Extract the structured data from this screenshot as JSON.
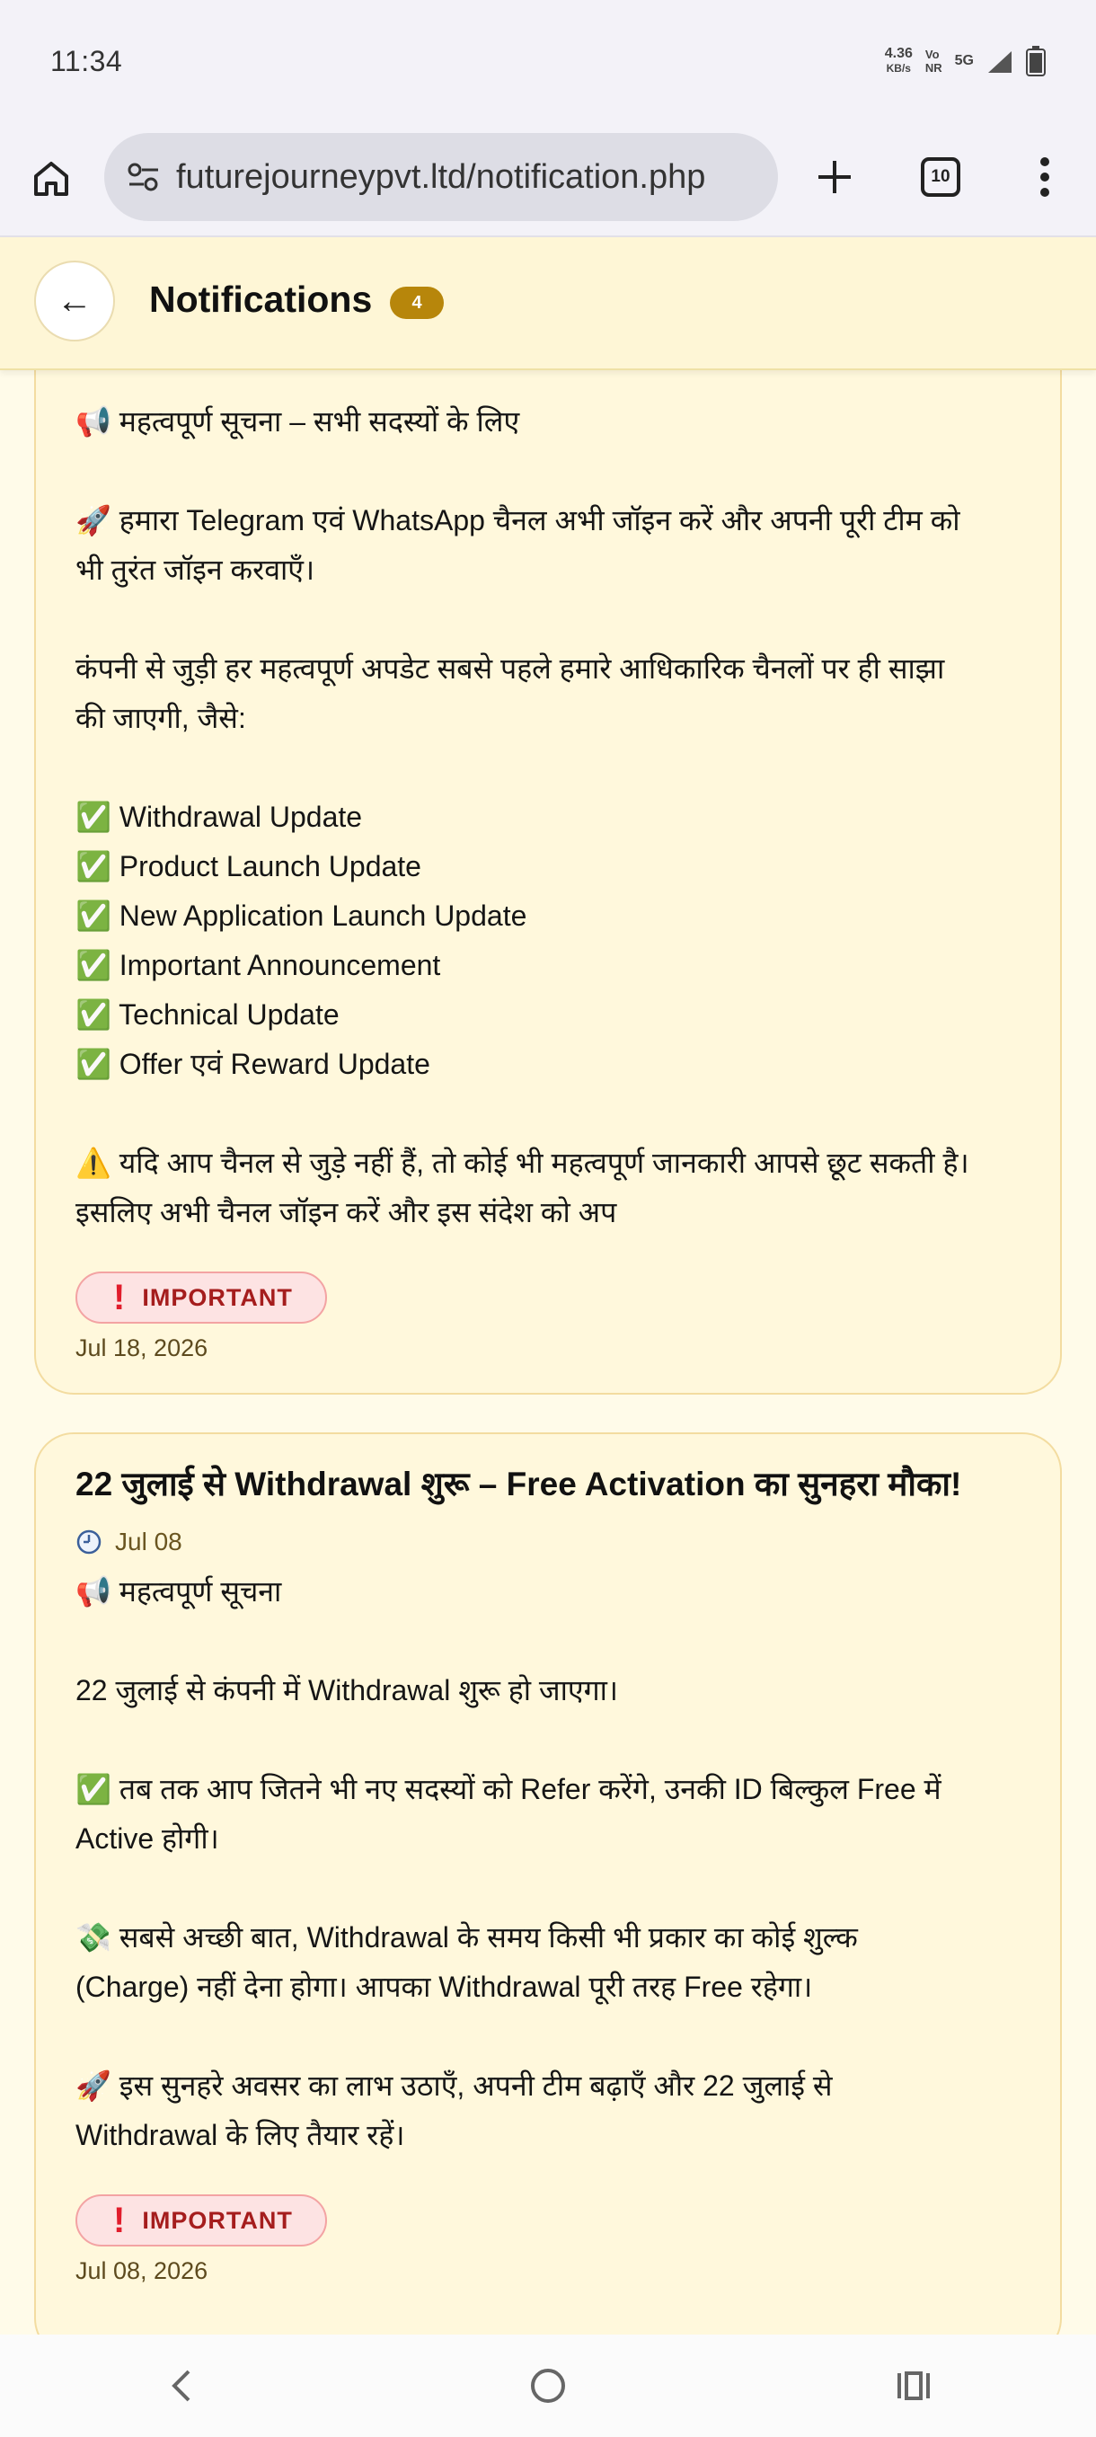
{
  "status_bar": {
    "time": "11:34",
    "net_speed_value": "4.36",
    "net_speed_unit": "KB/s",
    "volte_top": "Vo",
    "volte_bottom": "NR",
    "network": "5G"
  },
  "browser": {
    "url": "futurejourneypvt.ltd/notification.php",
    "tab_count": "10",
    "icons": [
      "home-icon",
      "site-settings-icon",
      "plus-icon",
      "tabs-icon",
      "more-vert-icon"
    ]
  },
  "header": {
    "back_arrow": "←",
    "title": "Notifications",
    "badge": "4"
  },
  "notifications": [
    {
      "lines": [
        "📢 महत्वपूर्ण सूचना – सभी सदस्यों के लिए",
        "",
        "🚀 हमारा Telegram एवं WhatsApp चैनल अभी जॉइन करें और अपनी पूरी टीम को",
        "भी तुरंत जॉइन करवाएँ।",
        "",
        "कंपनी से जुड़ी हर महत्वपूर्ण अपडेट सबसे पहले हमारे आधिकारिक चैनलों पर ही साझा",
        "की जाएगी, जैसे:",
        "",
        "✅ Withdrawal Update",
        "✅ Product Launch Update",
        "✅ New Application Launch Update",
        "✅ Important Announcement",
        "✅ Technical Update",
        "✅ Offer एवं Reward Update",
        "",
        "⚠️ यदि आप चैनल से जुड़े नहीं हैं, तो कोई भी महत्वपूर्ण जानकारी आपसे छूट सकती है।",
        "इसलिए अभी चैनल जॉइन करें और इस संदेश को अप"
      ],
      "badge_icon": "!",
      "badge": "IMPORTANT",
      "date": "Jul 18, 2026"
    },
    {
      "title": "22 जुलाई से Withdrawal शुरू – Free Activation का सुनहरा मौका!",
      "time_icon": "🕒",
      "short_date": "Jul 08",
      "lines": [
        "📢 महत्वपूर्ण सूचना",
        "",
        "22 जुलाई से कंपनी में Withdrawal शुरू हो जाएगा।",
        "",
        "✅ तब तक आप जितने भी नए सदस्यों को Refer करेंगे, उनकी ID बिल्कुल Free में",
        "Active होगी।",
        "",
        "💸 सबसे अच्छी बात, Withdrawal के समय किसी भी प्रकार का कोई शुल्क",
        "(Charge) नहीं देना होगा। आपका Withdrawal पूरी तरह Free रहेगा।",
        "",
        "🚀 इस सुनहरे अवसर का लाभ उठाएँ, अपनी टीम बढ़ाएँ और 22 जुलाई से",
        "Withdrawal के लिए तैयार रहें।"
      ],
      "badge_icon": "!",
      "badge": "IMPORTANT",
      "date": "Jul 08, 2026"
    }
  ],
  "nav": {
    "icons": [
      "back-nav-icon",
      "home-nav-icon",
      "recents-nav-icon"
    ]
  }
}
